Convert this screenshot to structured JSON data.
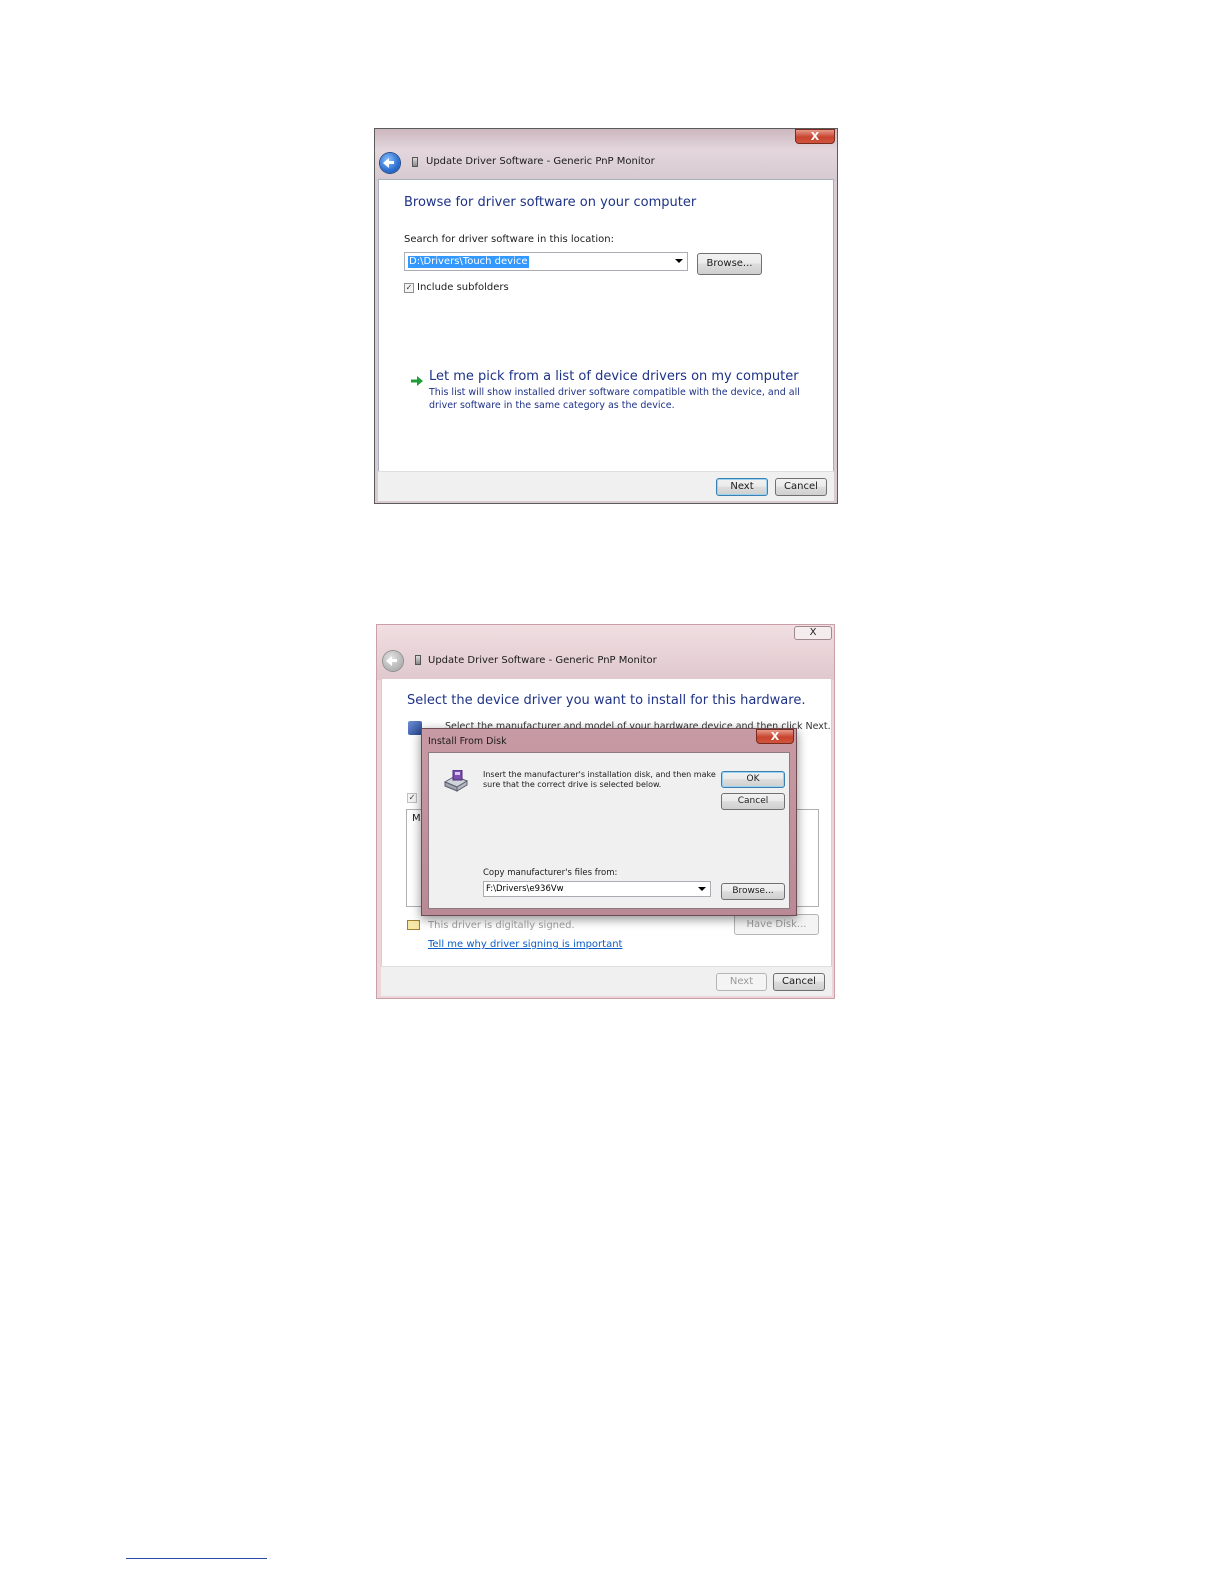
{
  "window1": {
    "title": "Update Driver Software - Generic PnP Monitor",
    "close_label": "X",
    "heading": "Browse for driver software on your computer",
    "search_label": "Search for driver software in this location:",
    "path_value": "D:\\Drivers\\Touch device",
    "browse_label": "Browse...",
    "subfolders_label": "Include subfolders",
    "subfolders_checked": true,
    "pick_title": "Let me pick from a list of device drivers on my computer",
    "pick_desc_line1": "This list will show installed driver software compatible with the device, and all",
    "pick_desc_line2": "driver software in the same category as the device.",
    "next_label": "Next",
    "cancel_label": "Cancel"
  },
  "window2": {
    "title": "Update Driver Software - Generic PnP Monitor",
    "close_label": "X",
    "heading": "Select the device driver you want to install for this hardware.",
    "instruction_partial": "Select the manufacturer and model of your hardware device and then click Next. If you",
    "signed_text": "This driver is digitally signed.",
    "signing_link": "Tell me why driver signing is important",
    "have_disk_label": "Have Disk...",
    "next_label": "Next",
    "cancel_label": "Cancel",
    "list_partial_text": "M"
  },
  "install_dialog": {
    "title": "Install From Disk",
    "close_label": "X",
    "instruction_line1": "Insert the manufacturer's installation disk, and then make",
    "instruction_line2": "sure that the correct drive is selected below.",
    "ok_label": "OK",
    "cancel_label": "Cancel",
    "copy_label": "Copy manufacturer's files from:",
    "path_value": "F:\\Drivers\\e936Vw",
    "browse_label": "Browse..."
  },
  "colors": {
    "heading_blue": "#1e3287",
    "link_blue": "#0b5dc8",
    "selection_blue": "#3399ff"
  }
}
